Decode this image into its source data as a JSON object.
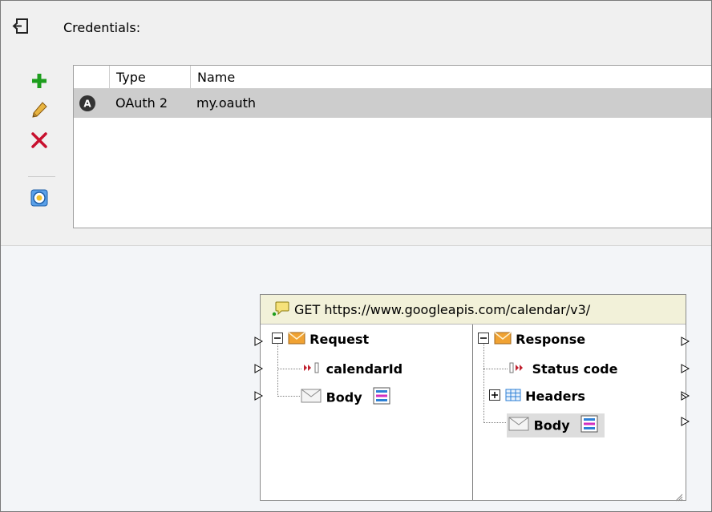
{
  "credentials": {
    "title": "Credentials:",
    "header_icon": "exit-icon",
    "columns": {
      "type": "Type",
      "name": "Name"
    },
    "rows": [
      {
        "badge": "A",
        "type": "OAuth 2",
        "name": "my.oauth"
      }
    ],
    "toolbar": [
      {
        "icon": "add-icon",
        "color": "#1e9e1e"
      },
      {
        "icon": "pencil-icon",
        "color": "#e2a72e"
      },
      {
        "icon": "delete-icon",
        "color": "#c8102e"
      },
      {
        "icon": "credential-settings-icon",
        "color": "#2878d0"
      }
    ]
  },
  "component": {
    "title": "GET https://www.googleapis.com/calendar/v3/",
    "title_icon": "comment-icon",
    "request": {
      "label": "Request",
      "children": [
        {
          "label": "calendarId",
          "icon": "parameter-icon"
        },
        {
          "label": "Body",
          "icon": "envelope-icon"
        }
      ]
    },
    "response": {
      "label": "Response",
      "children": [
        {
          "label": "Status code",
          "icon": "parameter-icon"
        },
        {
          "label": "Headers",
          "icon": "table-icon"
        },
        {
          "label": "Body",
          "icon": "envelope-icon"
        }
      ]
    }
  },
  "colors": {
    "title_bar": "#f2f1d9",
    "selected_row": "#cdcdcd",
    "envelope": "#f0a232",
    "headers_table": "#2c7fd6"
  }
}
